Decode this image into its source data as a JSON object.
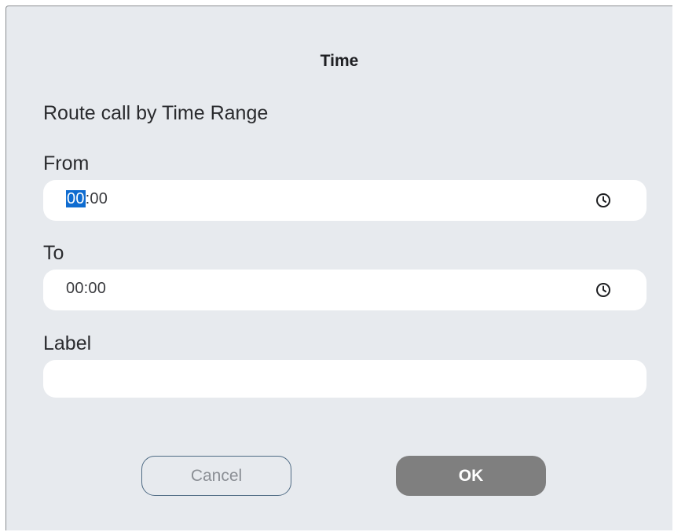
{
  "dialog": {
    "title": "Time",
    "subtitle": "Route call by Time Range"
  },
  "from": {
    "label": "From",
    "hours": "00",
    "separator": ":",
    "minutes": "00",
    "icon": "clock-icon"
  },
  "to": {
    "label": "To",
    "value": "00:00",
    "icon": "clock-icon"
  },
  "label_field": {
    "label": "Label",
    "value": ""
  },
  "buttons": {
    "cancel": "Cancel",
    "ok": "OK"
  },
  "colors": {
    "dialog_bg": "#e7eaee",
    "selection": "#0f6cd0",
    "ok_bg": "#7f7f7f",
    "cancel_border": "#4f6b84"
  }
}
